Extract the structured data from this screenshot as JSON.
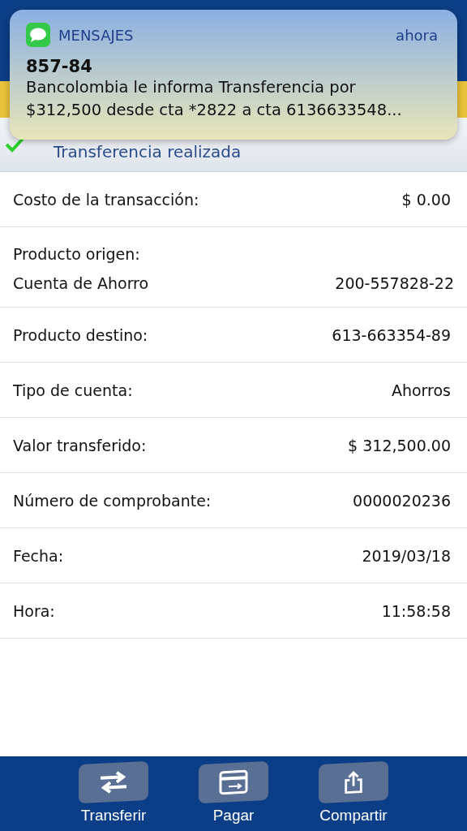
{
  "notification": {
    "app": "MENSAJES",
    "time": "ahora",
    "sender": "857-84",
    "message": "Bancolombia le informa Transferencia por $312,500 desde cta *2822 a cta 6136633548..."
  },
  "status": {
    "text": "Transferencia realizada"
  },
  "details": [
    {
      "label": "Costo de la transacción:",
      "value": "$ 0.00"
    },
    {
      "label": "Producto origen:",
      "sublabel": "Cuenta de Ahorro",
      "value": "200-557828-22"
    },
    {
      "label": "Producto destino:",
      "value": "613-663354-89"
    },
    {
      "label": "Tipo de cuenta:",
      "value": "Ahorros"
    },
    {
      "label": "Valor transferido:",
      "value": "$ 312,500.00"
    },
    {
      "label": "Número de comprobante:",
      "value": "0000020236"
    },
    {
      "label": "Fecha:",
      "value": "2019/03/18"
    },
    {
      "label": "Hora:",
      "value": "11:58:58"
    }
  ],
  "toolbar": [
    {
      "kind": "transfer",
      "label": "Transferir"
    },
    {
      "kind": "pay",
      "label": "Pagar"
    },
    {
      "kind": "share",
      "label": "Compartir"
    }
  ]
}
